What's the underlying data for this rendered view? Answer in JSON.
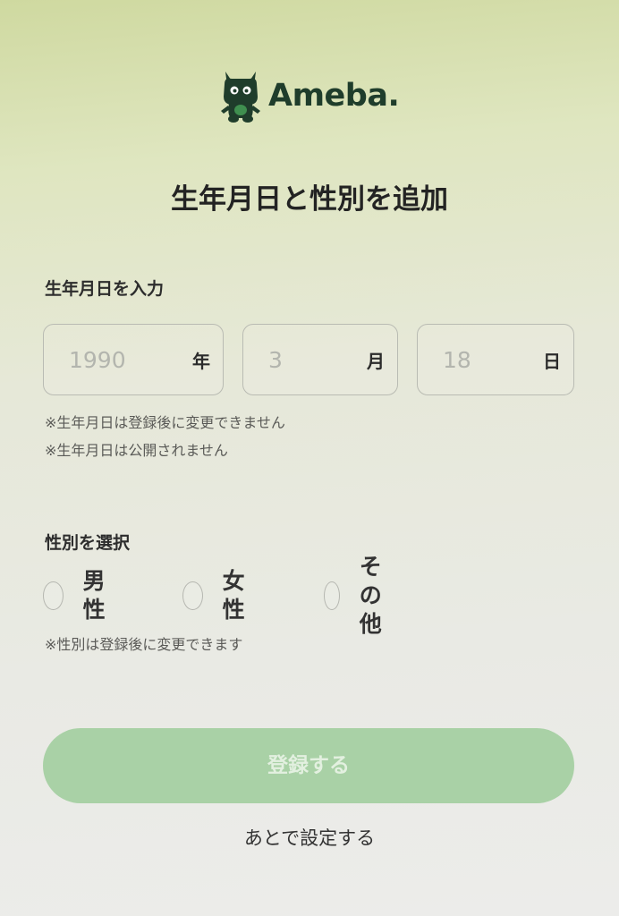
{
  "brand": {
    "name": "Ameba.",
    "color": "#1f3d2b",
    "mascot_icon": "ameba-mascot-icon"
  },
  "page": {
    "title": "生年月日と性別を追加"
  },
  "birthdate": {
    "label": "生年月日を入力",
    "year": {
      "placeholder": "1990",
      "unit": "年"
    },
    "month": {
      "placeholder": "3",
      "unit": "月"
    },
    "day": {
      "placeholder": "18",
      "unit": "日"
    },
    "notes": [
      "※生年月日は登録後に変更できません",
      "※生年月日は公開されません"
    ]
  },
  "gender": {
    "label": "性別を選択",
    "options": [
      "男性",
      "女性",
      "その他"
    ],
    "selected": null,
    "note": "※性別は登録後に変更できます"
  },
  "actions": {
    "register_label": "登録する",
    "register_disabled": true,
    "register_color": "#a9d1a6",
    "later_label": "あとで設定する"
  }
}
